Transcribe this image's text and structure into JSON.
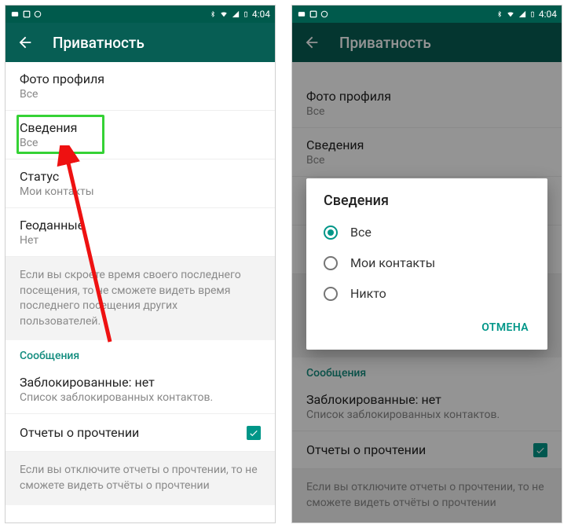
{
  "status": {
    "time": "4:04"
  },
  "header": {
    "title": "Приватность"
  },
  "items": {
    "photo": {
      "title": "Фото профиля",
      "sub": "Все"
    },
    "about": {
      "title": "Сведения",
      "sub": "Все"
    },
    "status": {
      "title": "Статус",
      "sub": "Мои контакты"
    },
    "geo": {
      "title": "Геоданные",
      "sub": "Нет"
    }
  },
  "info1": "Если вы скроете время своего последнего посещения, то не сможете видеть время последнего посещения других пользователей.",
  "section_messages": "Сообщения",
  "blocked": {
    "title": "Заблокированные: нет",
    "sub": "Список заблокированных контактов."
  },
  "read_receipts": "Отчеты о прочтении",
  "info2": "Если вы отключите отчеты о прочтении, то не сможете видеть отчёты о прочтении",
  "dialog": {
    "title": "Сведения",
    "opt_all": "Все",
    "opt_contacts": "Мои контакты",
    "opt_nobody": "Никто",
    "cancel": "ОТМЕНА"
  }
}
